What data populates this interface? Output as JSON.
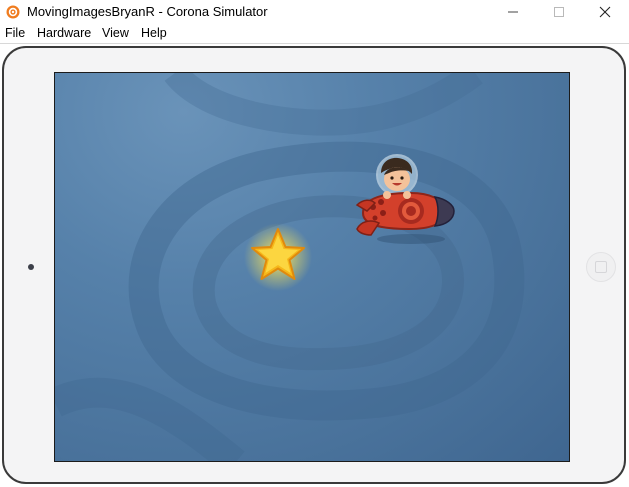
{
  "window": {
    "title": "MovingImagesBryanR - Corona Simulator",
    "icon": "corona-app-icon",
    "controls": [
      "minimize-icon",
      "maximize-icon",
      "close-icon"
    ]
  },
  "menu": {
    "items": [
      "File",
      "Hardware",
      "View",
      "Help"
    ]
  },
  "device": {
    "skin": "tablet",
    "frame_color": "#f4f4f5"
  },
  "scene": {
    "background_color": "#4d77a0",
    "sprites": [
      {
        "name": "star",
        "icon": "star-icon",
        "color": "#f7c51c"
      },
      {
        "name": "rocket-ship",
        "icon": "astronaut-rocket-icon",
        "color": "#d0422d"
      }
    ]
  }
}
